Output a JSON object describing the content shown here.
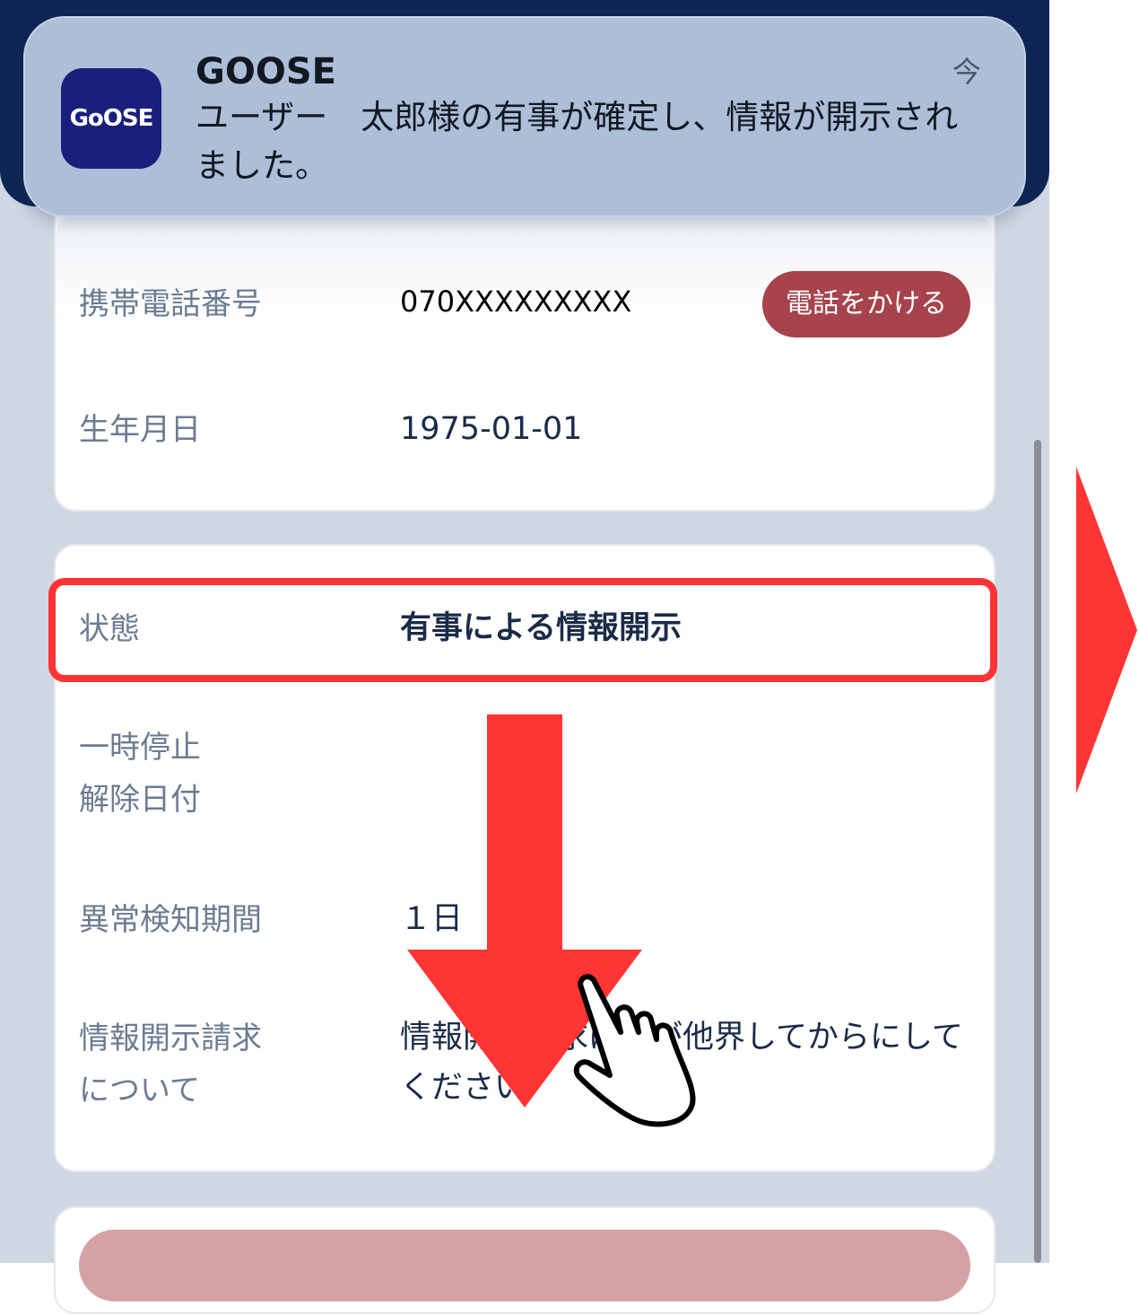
{
  "notification": {
    "app_name": "GOOSE",
    "icon_text": "GoOSE",
    "time": "今",
    "message": "ユーザー　太郎様の有事が確定し、情報が開示されました。"
  },
  "details": {
    "phone": {
      "label": "携帯電話番号",
      "value": "070XXXXXXXXX",
      "call_button": "電話をかける"
    },
    "birthday": {
      "label": "生年月日",
      "value": "1975-01-01"
    },
    "status": {
      "label": "状態",
      "value": "有事による情報開示"
    },
    "pause_release": {
      "label": "一時停止\n解除日付",
      "value": ""
    },
    "detection_period": {
      "label": "異常検知期間",
      "value": "１日"
    },
    "disclosure": {
      "label": "情報開示請求\nについて",
      "value": "情報開示請求は私が他界してからにしてください"
    }
  },
  "colors": {
    "header": "#0e2654",
    "call_button": "#a6434d",
    "highlight": "#ff3434",
    "annotation_arrow": "#ff3434"
  },
  "icons": [
    "goose-app-icon",
    "down-arrow-icon",
    "pointer-hand-icon",
    "right-arrow-icon"
  ]
}
